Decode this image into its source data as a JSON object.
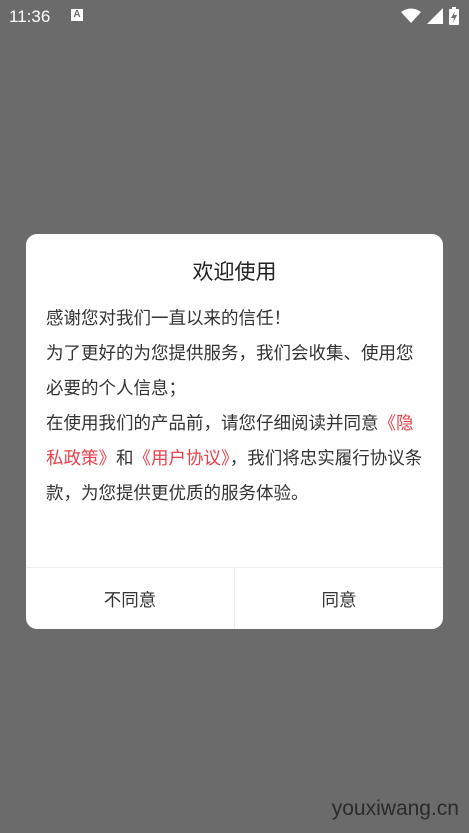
{
  "status_bar": {
    "time": "11:36",
    "notification_icon": "text-a-notification-icon",
    "wifi_icon": "wifi-icon",
    "signal_icon": "signal-icon",
    "battery_icon": "battery-charging-icon"
  },
  "dialog": {
    "title": "欢迎使用",
    "line1": "感谢您对我们一直以来的信任！",
    "line2": "为了更好的为您提供服务，我们会收集、使用您必要的个人信息；",
    "line3_pre": "在使用我们的产品前，请您仔细阅读并同意",
    "privacy_link": "《隐私政策》",
    "and": "和",
    "agreement_link": "《用户协议》",
    "line3_post": "，我们将忠实履行协议条款，为您提供更优质的服务体验。",
    "disagree_label": "不同意",
    "agree_label": "同意"
  },
  "colors": {
    "overlay": "#6b6b6b",
    "link": "#e8404b",
    "text": "#333333"
  },
  "watermark": "youxiwang.cn"
}
